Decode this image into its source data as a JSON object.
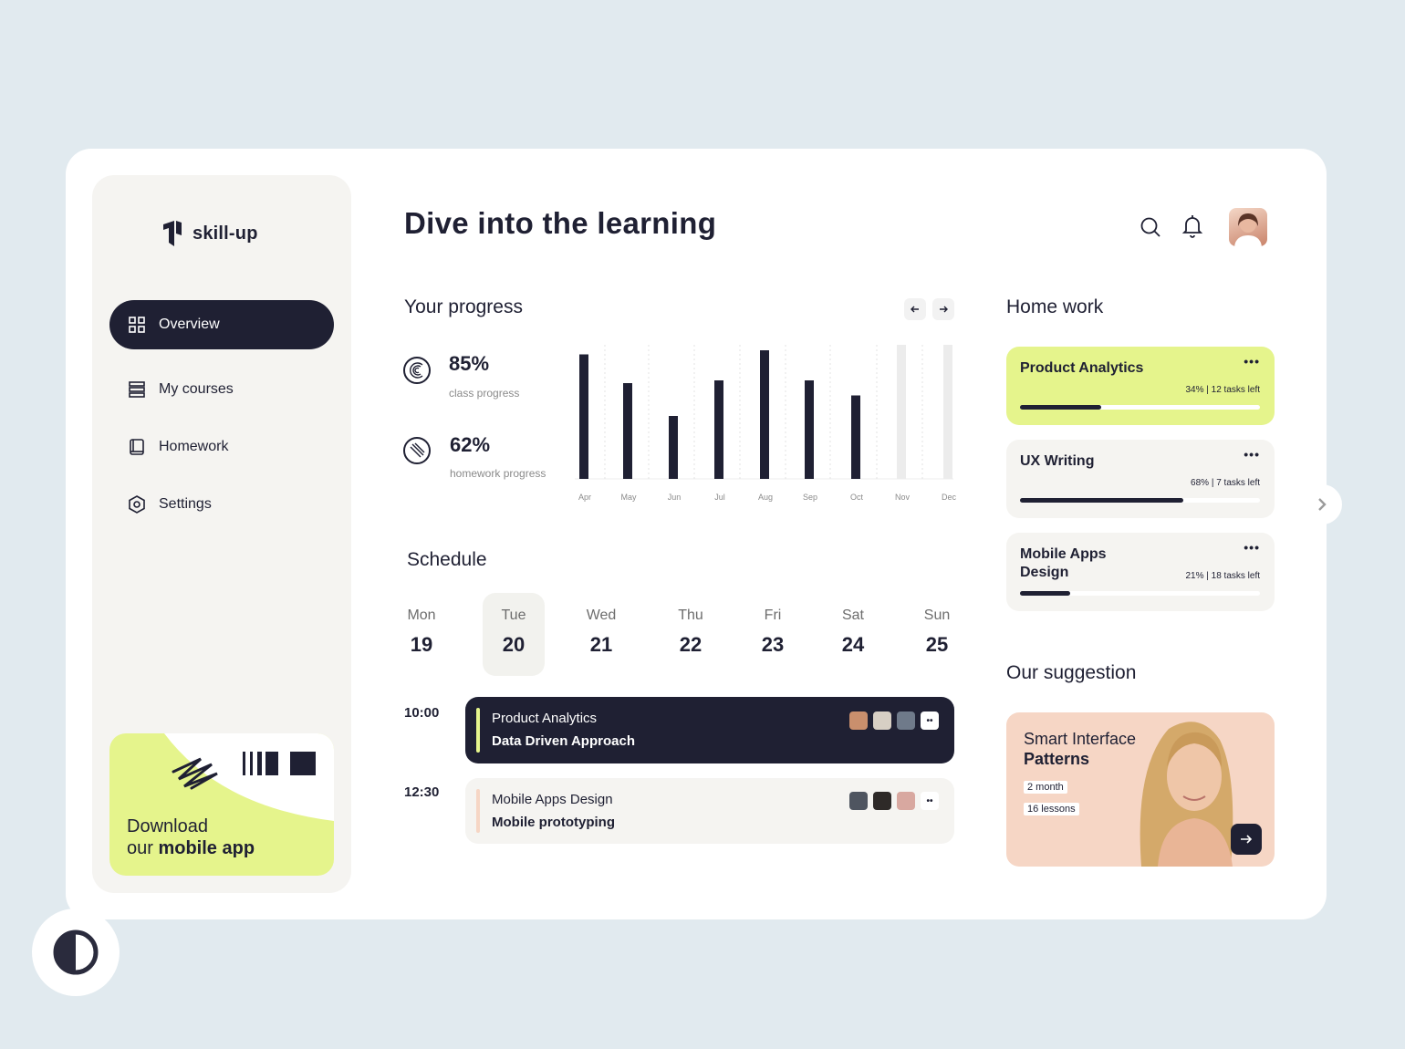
{
  "brand": {
    "name": "skill-up"
  },
  "nav": [
    {
      "label": "Overview",
      "icon": "grid-icon",
      "active": true
    },
    {
      "label": "My courses",
      "icon": "stack-icon",
      "active": false
    },
    {
      "label": "Homework",
      "icon": "book-icon",
      "active": false
    },
    {
      "label": "Settings",
      "icon": "settings-icon",
      "active": false
    }
  ],
  "promo": {
    "line1": "Download",
    "line2_prefix": "our ",
    "line2_bold": "mobile app"
  },
  "header": {
    "title_prefix": "Dive into the ",
    "title_bold": "learning"
  },
  "progress": {
    "title": "Your progress",
    "stats": [
      {
        "value": "85%",
        "label": "class progress"
      },
      {
        "value": "62%",
        "label": "homework progress"
      }
    ]
  },
  "chart_data": {
    "type": "bar",
    "title": "Your progress",
    "categories": [
      "Apr",
      "May",
      "Jun",
      "Jul",
      "Aug",
      "Sep",
      "Oct",
      "Nov",
      "Dec"
    ],
    "values": [
      91,
      70,
      46,
      72,
      94,
      72,
      61,
      null,
      null
    ],
    "ylim": [
      0,
      100
    ],
    "grid": "dotted vertical",
    "colors": {
      "bar": "#1f2033",
      "empty": "#ececec"
    }
  },
  "schedule": {
    "title": "Schedule",
    "days": [
      {
        "name": "Mon",
        "num": "19"
      },
      {
        "name": "Tue",
        "num": "20",
        "selected": true
      },
      {
        "name": "Wed",
        "num": "21"
      },
      {
        "name": "Thu",
        "num": "22"
      },
      {
        "name": "Fri",
        "num": "23"
      },
      {
        "name": "Sat",
        "num": "24"
      },
      {
        "name": "Sun",
        "num": "25"
      }
    ],
    "events": [
      {
        "time": "10:00",
        "course": "Product Analytics",
        "topic": "Data Driven Approach",
        "dark": true,
        "more": "••"
      },
      {
        "time": "12:30",
        "course": "Mobile Apps Design",
        "topic": "Mobile prototyping",
        "dark": false,
        "more": "••"
      }
    ]
  },
  "homework": {
    "title": "Home work",
    "items": [
      {
        "title": "Product Analytics",
        "meta": "34% | 12 tasks left",
        "progress": 0.34,
        "color": "#e5f48c"
      },
      {
        "title": "UX Writing",
        "meta": "68% | 7 tasks left",
        "progress": 0.68,
        "color": "#f5f4f1"
      },
      {
        "title": "Mobile Apps Design",
        "meta": "21% | 18 tasks left",
        "progress": 0.21,
        "color": "#f5f4f1"
      }
    ],
    "dots": "•••"
  },
  "suggestion": {
    "title": "Our suggestion",
    "card_line1": "Smart Interface",
    "card_line2": "Patterns",
    "duration": "2 month",
    "lessons": "16 lessons",
    "button_icon": "arrow-right-icon"
  },
  "colors": {
    "dark": "#1f2033",
    "lime": "#e5f48c",
    "peach": "#f6d6c5",
    "bg": "#e1eaef"
  }
}
